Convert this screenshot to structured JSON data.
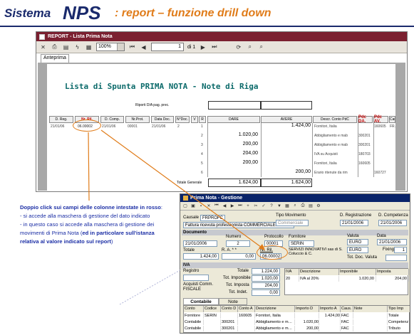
{
  "header": {
    "system": "Sistema",
    "nps": "NPS",
    "subtitle": ": report – funzione drill down"
  },
  "report_window": {
    "title": "REPORT - Lista Prima Nota",
    "zoom": "100%",
    "page_num": "1",
    "page_of": "di 1",
    "tab": "Anteprima",
    "report_title": "Lista di Spunta PRIMA NOTA - Note di Riga",
    "riporti_label": "Riporti D/A pag. prec.",
    "columns": [
      "D. Reg.",
      "Nr. Ril.",
      "D. Comp.",
      "Nr.Prot.",
      "Data Doc.",
      "N°Doc.",
      "V",
      "R",
      "DARE",
      "AVERE",
      "Descr. Conto PdC",
      "Pdc DA.",
      "Pdc AV.",
      "Cau."
    ],
    "row_first": {
      "d_reg": "21/01/06",
      "nr_ril": "06.00002",
      "d_comp": "21/01/06",
      "nr_prot": "00001",
      "data_doc": "21/01/06",
      "n_doc": "2",
      "v": "",
      "r": "1"
    },
    "rows": [
      {
        "r": "1",
        "dare": "",
        "avere": "1.424,00",
        "descr": "Fornitori, Italia",
        "pdc_da": "",
        "pdc_av": "160605",
        "cau": "FR.PRO"
      },
      {
        "r": "2",
        "dare": "1.020,00",
        "avere": "",
        "descr": "Abbigliamento e mab",
        "pdc_da": "300201",
        "pdc_av": "",
        "cau": ""
      },
      {
        "r": "3",
        "dare": "200,00",
        "avere": "",
        "descr": "Abbigliamento e mab",
        "pdc_da": "300201",
        "pdc_av": "",
        "cau": ""
      },
      {
        "r": "4",
        "dare": "204,00",
        "avere": "",
        "descr": "IVA su Acquisti",
        "pdc_da": "180703",
        "pdc_av": "",
        "cau": ""
      },
      {
        "r": "5",
        "dare": "200,00",
        "avere": "",
        "descr": "Fornitori, Italia",
        "pdc_da": "160605",
        "pdc_av": "",
        "cau": ""
      },
      {
        "r": "6",
        "dare": "",
        "avere": "200,00",
        "descr": "Erario ritenute da rim",
        "pdc_da": "",
        "pdc_av": "160727",
        "cau": ""
      }
    ],
    "totale_label": "Totale Generale",
    "totale_dare": "1.624,00",
    "totale_avere": "1.624,00"
  },
  "annotation": {
    "line1": "Doppio  click sui campi delle colonne  intestate in rosso",
    "colon": ":",
    "line2": "- si accede alla maschera di gestione del dato indicato",
    "line3": "- in questo caso si accede alla maschera di gestione dei movimenti di Prima Nota (",
    "line3b": "ed in particolare sull'istanza relativa al valore indicato  sul report",
    "line3c": ")"
  },
  "gestione_window": {
    "title": "Prima Nota - Gestione",
    "causale_label": "Causale",
    "causale_code": "FRPROFC",
    "causale_desc": "Fattura ricevuta professionista COMMERCIALE",
    "tipo_mov_label": "Tipo Movimento",
    "tipo_mov_value": "Commerciale",
    "d_reg_label": "D. Registrazione",
    "d_reg_value": "21/01/2006",
    "d_comp_label": "D. Competenza",
    "d_comp_value": "21/01/2006",
    "documento_label": "Documento",
    "numero_label": "Numero",
    "numero_value": "2",
    "protocollo_label": "Protocollo",
    "protocollo_value": "00001",
    "fornitore_label": "Fornitore",
    "fornitore_code": "SERIN",
    "fornitore_name": "SERVIZI INNOVATIVI sas di S. Coluccio & C.",
    "doc_date": "21/01/2006",
    "valuta_label": "Valuta",
    "valuta_value": "EURO",
    "data_label": "Data",
    "data_value": "21/01/2006",
    "valuta2": "EURO",
    "fixing_label": "Fixing",
    "fixing_value": "1",
    "totale_label": "Totale",
    "totale_value": "1.424,00",
    "ra_label": "R. A. * *",
    "ra_value": "0,00",
    "nr_ril_label": "Nr. Ril.",
    "nr_ril_value": "06.00002",
    "tot_doc_val_label": "Tot. Doc. Valuta",
    "iva_label": "IVA",
    "registro_label": "Registro",
    "acquisti_label": "Acquisti Comm. FISCALE",
    "iva_totale_label": "Totale",
    "iva_totale_value": "1.224,00",
    "tot_imp_label": "Tot. Imponibile",
    "tot_imp_value": "1.020,00",
    "tot_imposta_label": "Tot. Imposta",
    "tot_imposta_value": "204,00",
    "tot_indet_label": "Tot. Indet.",
    "tot_indet_value": "0,00",
    "iva_cols": [
      "IVA",
      "Descrizione",
      "Imponibile",
      "Imposta"
    ],
    "iva_row": [
      "20",
      "IVA al 20%",
      "1.020,00",
      "204,00"
    ],
    "tabs": [
      "Contabile",
      "Note"
    ],
    "cont_cols": [
      "Conto",
      "Codice",
      "Conto D",
      "Conto A",
      "Descrizione",
      "Importo D",
      "Importo A",
      "Caus.",
      "Note",
      "Tipo Imp"
    ],
    "cont_rows": [
      [
        "Fornitore",
        "SERIN",
        "",
        "160605",
        "Fornitori, Italia",
        "",
        "1.424,00",
        "FAC",
        "",
        "Totale"
      ],
      [
        "Contabile",
        "",
        "300201",
        "",
        "Abbigliamento e m…",
        "1.020,00",
        "",
        "FAC",
        "",
        "Competenz"
      ],
      [
        "Contabile",
        "",
        "300201",
        "",
        "Abbigliamento e m…",
        "200,00",
        "",
        "FAC",
        "",
        "Tributo"
      ]
    ]
  },
  "colors": {
    "brand": "#1a2a6c",
    "accent": "#e07c1a",
    "red_header": "#c00000",
    "annotation": "#1b2ea5"
  }
}
